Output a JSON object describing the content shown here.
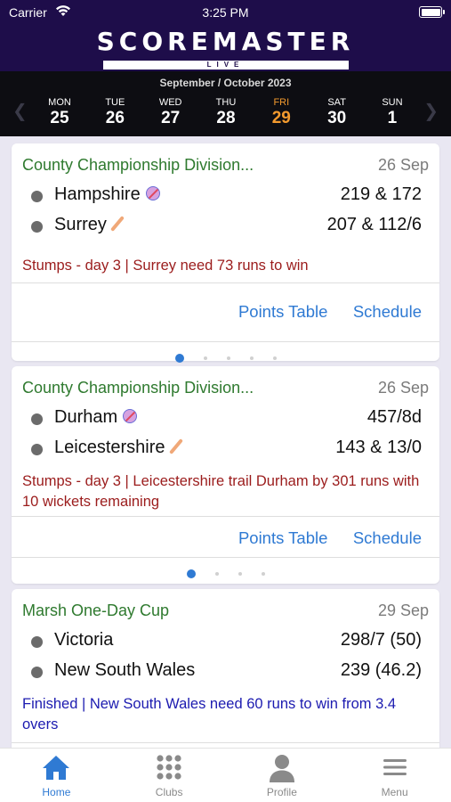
{
  "status_bar": {
    "carrier": "Carrier",
    "time": "3:25 PM"
  },
  "brand": {
    "title": "SCOREMASTER",
    "subtitle": "LIVE"
  },
  "calendar": {
    "month": "September / October 2023",
    "days": [
      {
        "name": "MON",
        "num": "25"
      },
      {
        "name": "TUE",
        "num": "26"
      },
      {
        "name": "WED",
        "num": "27"
      },
      {
        "name": "THU",
        "num": "28"
      },
      {
        "name": "FRI",
        "num": "29"
      },
      {
        "name": "SAT",
        "num": "30"
      },
      {
        "name": "SUN",
        "num": "1"
      }
    ],
    "selected_day": "FRI",
    "accent_color": "#f39a2e"
  },
  "matches": [
    {
      "competition": "County Championship Division...",
      "date": "26 Sep",
      "teams": [
        {
          "name": "Hampshire",
          "score": "219 & 172",
          "icon": "ball-icon"
        },
        {
          "name": "Surrey",
          "score": "207 & 112/6",
          "icon": "bat-icon"
        }
      ],
      "status": "Stumps - day 3 | Surrey need 73 runs to win",
      "links": [
        "Points Table",
        "Schedule"
      ],
      "pages": 5,
      "active_page": 1
    },
    {
      "competition": "County Championship Division...",
      "date": "26 Sep",
      "teams": [
        {
          "name": "Durham",
          "score": "457/8d",
          "icon": "ball-icon"
        },
        {
          "name": "Leicestershire",
          "score": "143 & 13/0",
          "icon": "bat-icon"
        }
      ],
      "status": "Stumps - day 3 | Leicestershire trail Durham by 301 runs with 10 wickets remaining",
      "links": [
        "Points Table",
        "Schedule"
      ],
      "pages": 4,
      "active_page": 1
    },
    {
      "competition": "Marsh One-Day Cup",
      "date": "29 Sep",
      "teams": [
        {
          "name": "Victoria",
          "score": "298/7 (50)"
        },
        {
          "name": "New South Wales",
          "score": "239 (46.2)"
        }
      ],
      "status": "Finished | New South Wales need 60 runs to win from 3.4 overs"
    }
  ],
  "tabs": [
    {
      "label": "Home",
      "icon": "home-icon",
      "active": true
    },
    {
      "label": "Clubs",
      "icon": "grid-icon",
      "active": false
    },
    {
      "label": "Profile",
      "icon": "person-icon",
      "active": false
    },
    {
      "label": "Menu",
      "icon": "hamburger-icon",
      "active": false
    }
  ],
  "colors": {
    "header_bg": "#1e0d4a",
    "competition": "#2f7a2f",
    "status_red": "#9b1c1c",
    "status_blue": "#1c1bb0",
    "link": "#2f7ad3"
  }
}
